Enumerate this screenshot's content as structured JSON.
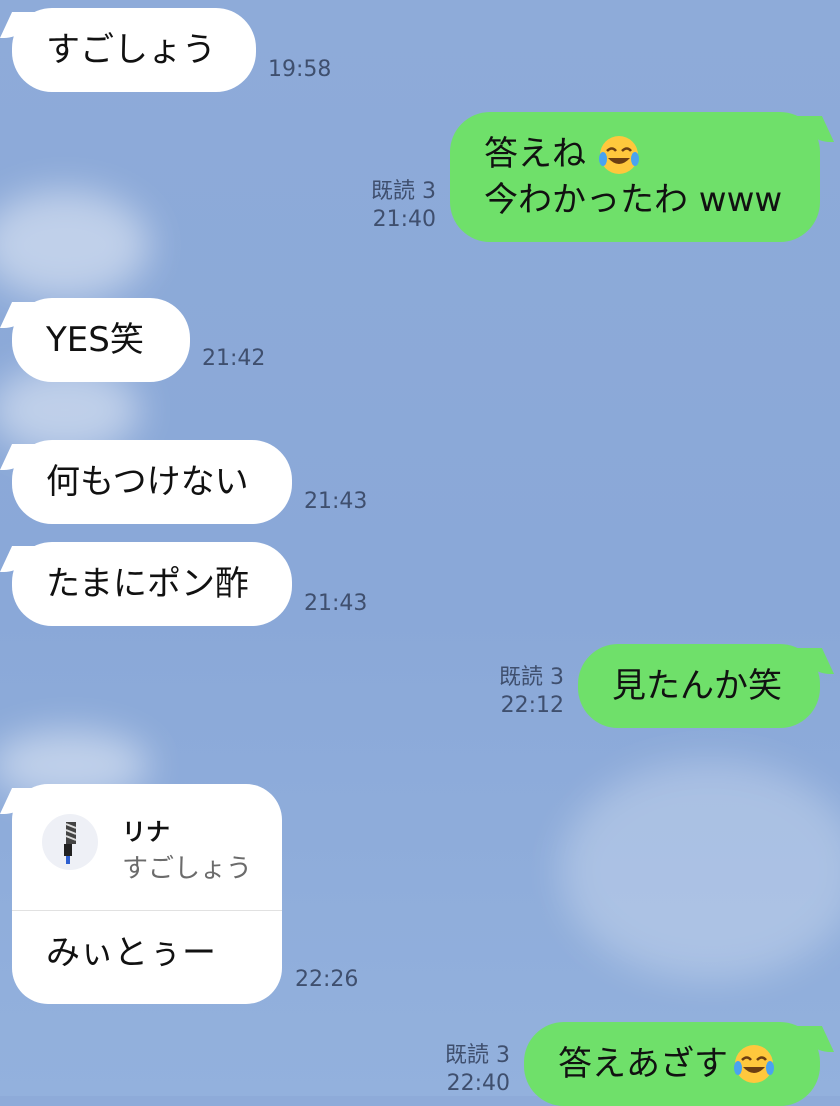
{
  "messages": [
    {
      "id": "m1",
      "side": "in",
      "text": "すごしょう",
      "time": "19:58"
    },
    {
      "id": "m2",
      "side": "out",
      "line1": "答えね",
      "line2": "今わかったわ www",
      "read": "既読 3",
      "time": "21:40",
      "emoji": "face-with-tears-of-joy"
    },
    {
      "id": "m3",
      "side": "in",
      "text": "YES笑",
      "time": "21:42"
    },
    {
      "id": "m4",
      "side": "in",
      "text": "何もつけない",
      "time": "21:43"
    },
    {
      "id": "m5",
      "side": "in",
      "text": "たまにポン酢",
      "time": "21:43"
    },
    {
      "id": "m6",
      "side": "out",
      "text": "見たんか笑",
      "read": "既読 3",
      "time": "22:12"
    },
    {
      "id": "m7",
      "side": "in",
      "quote_name": "リナ",
      "quote_text": "すごしょう",
      "text": "みぃとぅー",
      "time": "22:26"
    },
    {
      "id": "m8",
      "side": "out",
      "text": "答えあざす",
      "read": "既読 3",
      "time": "22:40",
      "emoji": "face-with-tears-of-joy"
    }
  ],
  "colors": {
    "background": "#8eabd9",
    "incoming_bubble": "#ffffff",
    "outgoing_bubble": "#6fe06a",
    "meta_text": "#3f4f6e"
  }
}
